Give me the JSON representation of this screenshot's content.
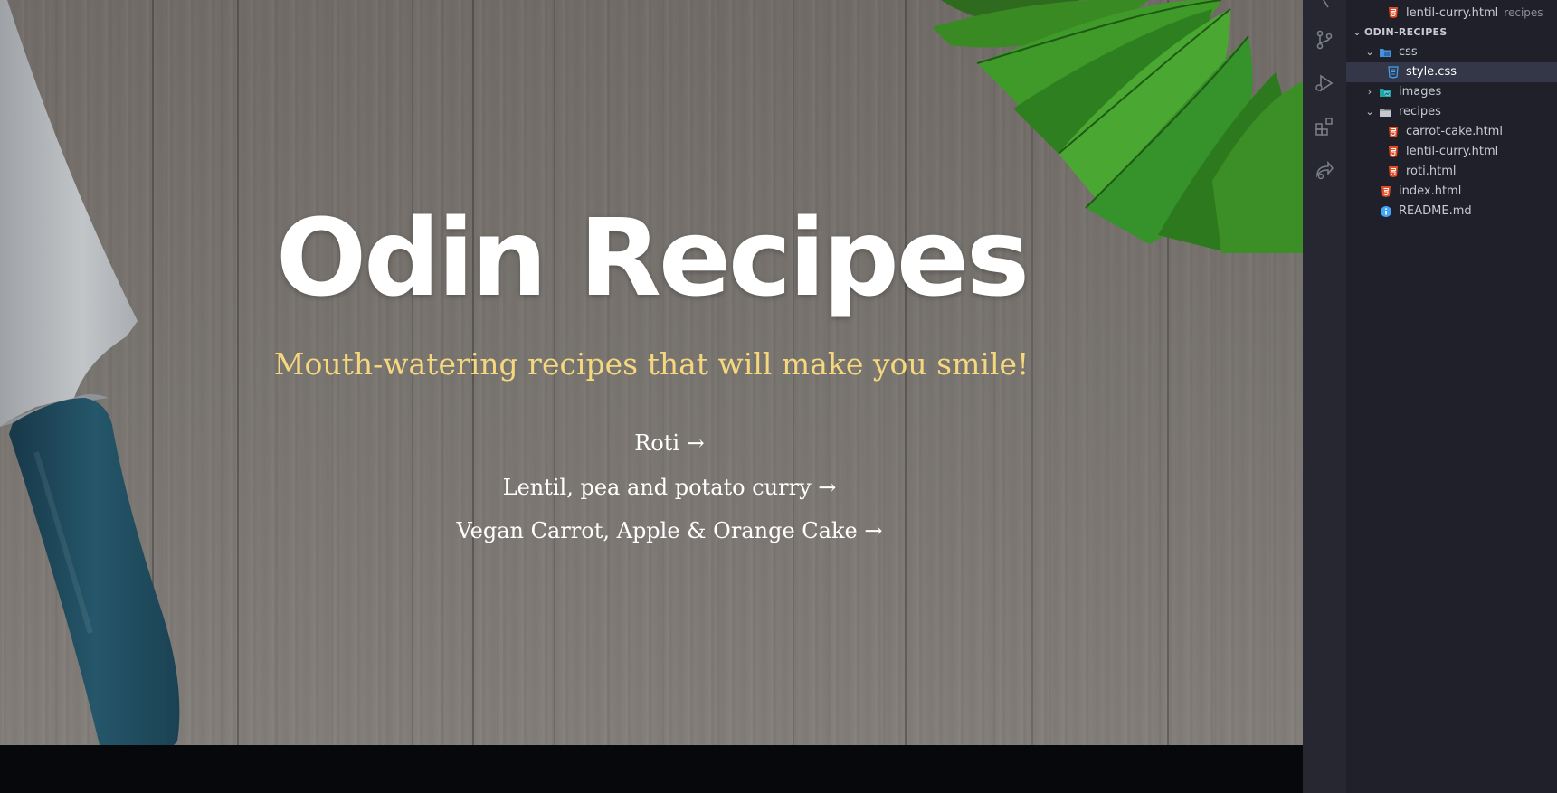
{
  "preview": {
    "title": "Odin Recipes",
    "subtitle": "Mouth-watering recipes that will make you smile!",
    "recipes": [
      {
        "label": "Roti →"
      },
      {
        "label": "Lentil, pea and potato curry →"
      },
      {
        "label": "Vegan Carrot, Apple & Orange Cake →"
      }
    ]
  },
  "colors": {
    "title": "#ffffff",
    "subtitle": "#f5d77e",
    "links": "#ffffff",
    "sidebar_bg": "#1f2029",
    "selected_row": "#343747"
  },
  "explorer": {
    "open_editor": {
      "label": "lentil-curry.html",
      "description": "recipes",
      "icon": "html5-icon"
    },
    "project_label": "ODIN-RECIPES",
    "tree": {
      "css": {
        "label": "css",
        "icon": "folder-icon"
      },
      "style": {
        "label": "style.css",
        "icon": "css-file-icon"
      },
      "images": {
        "label": "images",
        "icon": "images-folder-icon"
      },
      "recipes": {
        "label": "recipes",
        "icon": "folder-icon"
      },
      "carrot": {
        "label": "carrot-cake.html",
        "icon": "html5-icon"
      },
      "lentil": {
        "label": "lentil-curry.html",
        "icon": "html5-icon"
      },
      "roti": {
        "label": "roti.html",
        "icon": "html5-icon"
      },
      "index": {
        "label": "index.html",
        "icon": "html5-icon"
      },
      "readme": {
        "label": "README.md",
        "icon": "info-icon"
      }
    }
  },
  "activity_bar": [
    "source-control-icon",
    "run-debug-icon",
    "extensions-icon",
    "remote-share-icon"
  ]
}
